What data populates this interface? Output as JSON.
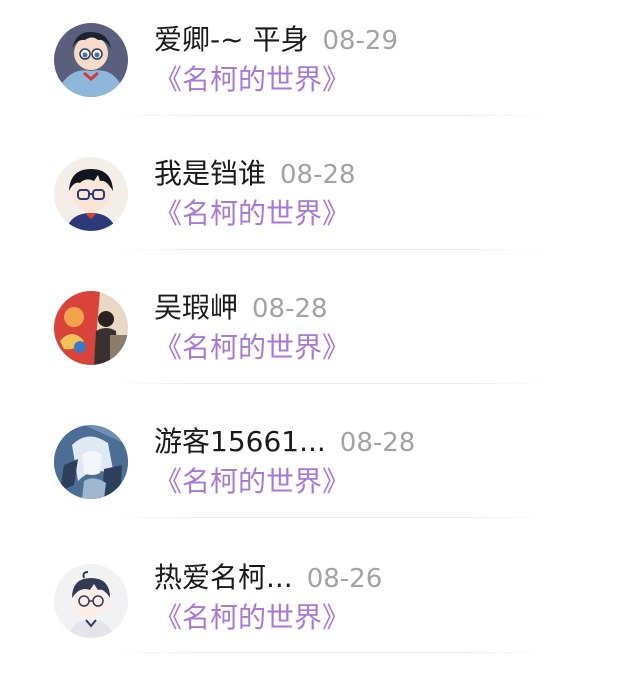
{
  "comments": [
    {
      "name": "爱卿-~ 平身",
      "date": "08-29",
      "book": "《名柯的世界》",
      "avatar_icon": "conan-lying-avatar-icon",
      "avatar_colors": {
        "bg": "#5a5f7e",
        "accent": "#8fb7d9"
      }
    },
    {
      "name": "我是铛谁",
      "date": "08-28",
      "book": "《名柯的世界》",
      "avatar_icon": "conan-face-avatar-icon",
      "avatar_colors": {
        "bg": "#f3efe8",
        "accent": "#2c3a7a"
      }
    },
    {
      "name": "吴瑕岬",
      "date": "08-28",
      "book": "《名柯的世界》",
      "avatar_icon": "red-painting-avatar-icon",
      "avatar_colors": {
        "bg": "#d9443a",
        "accent": "#f2a24a"
      }
    },
    {
      "name": "游客15661...",
      "date": "08-28",
      "book": "《名柯的世界》",
      "avatar_icon": "blue-anime-avatar-icon",
      "avatar_colors": {
        "bg": "#6f8fb3",
        "accent": "#dfe9f3"
      }
    },
    {
      "name": "热爱名柯...",
      "date": "08-26",
      "book": "《名柯的世界》",
      "avatar_icon": "glasses-boy-avatar-icon",
      "avatar_colors": {
        "bg": "#f2f2f4",
        "accent": "#333a55"
      }
    }
  ]
}
